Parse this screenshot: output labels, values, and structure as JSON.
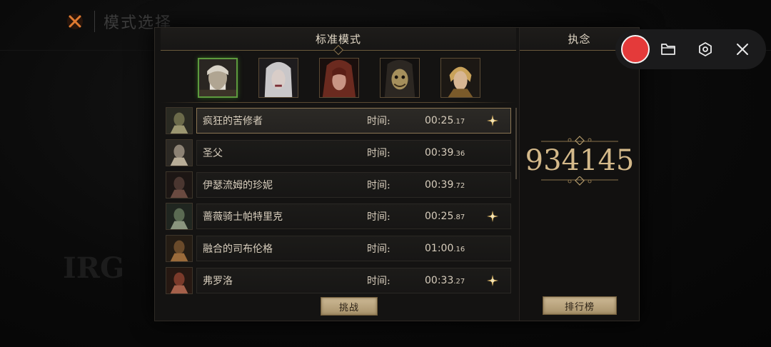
{
  "background": {
    "title": "模式选择",
    "big_text": "IRG",
    "sub_text": "",
    "sub_text2": ""
  },
  "panel": {
    "left_header": "标准模式",
    "right_header": "执念",
    "portraits": [
      {
        "name": "portrait-1",
        "active": true
      },
      {
        "name": "portrait-2",
        "active": false
      },
      {
        "name": "portrait-3",
        "active": false
      },
      {
        "name": "portrait-4",
        "active": false
      },
      {
        "name": "portrait-5",
        "active": false
      }
    ],
    "rows": [
      {
        "name": "疯狂的苦修者",
        "label": "时间:",
        "time_main": "00:25",
        "time_ms": ".17",
        "star": true,
        "selected": true
      },
      {
        "name": "圣父",
        "label": "时间:",
        "time_main": "00:39",
        "time_ms": ".36",
        "star": false,
        "selected": false
      },
      {
        "name": "伊瑟流姆的珍妮",
        "label": "时间:",
        "time_main": "00:39",
        "time_ms": ".72",
        "star": false,
        "selected": false
      },
      {
        "name": "蔷薇骑士帕特里克",
        "label": "时间:",
        "time_main": "00:25",
        "time_ms": ".87",
        "star": true,
        "selected": false
      },
      {
        "name": "融合的司布伦格",
        "label": "时间:",
        "time_main": "01:00",
        "time_ms": ".16",
        "star": false,
        "selected": false
      },
      {
        "name": "弗罗洛",
        "label": "时间:",
        "time_main": "00:33",
        "time_ms": ".27",
        "star": true,
        "selected": false
      }
    ],
    "challenge_button": "挑战",
    "rank_button": "排行榜",
    "score": "934145"
  },
  "recorder": {
    "record": "record-icon",
    "folder": "folder-icon",
    "settings": "settings-icon",
    "close": "close-icon"
  },
  "colors": {
    "accent_gold": "#d4b98a",
    "active_green": "#5d9a3e",
    "record_red": "#e43a3a"
  }
}
